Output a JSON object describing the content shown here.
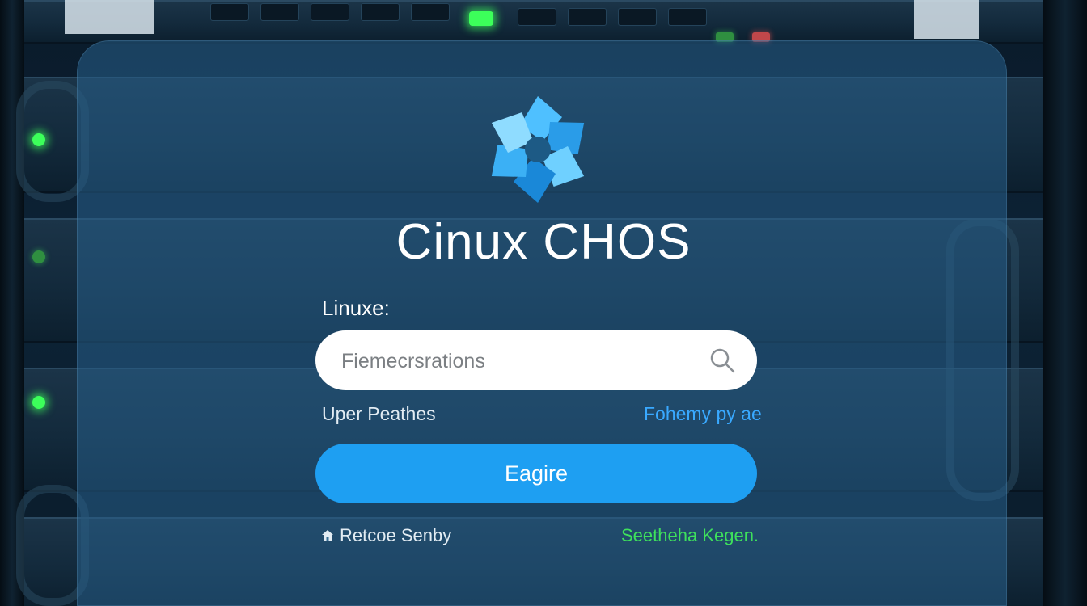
{
  "app": {
    "title": "Cinux CHOS",
    "logo_icon": "aperture-icon"
  },
  "login": {
    "field_label": "Linuxe:",
    "search_placeholder": "Fiemecrsrations",
    "search_icon": "search-icon",
    "left_link": "Uper Peathes",
    "right_link": "Fohemy py ae",
    "primary_button": "Eagire",
    "footer_left_icon": "home-icon",
    "footer_left": "Retcoe Senby",
    "footer_right": "Seetheha Kegen."
  },
  "colors": {
    "accent_blue": "#1e9ff2",
    "link_blue": "#39a9ff",
    "status_green": "#3ee05c",
    "panel": "#28608c"
  }
}
